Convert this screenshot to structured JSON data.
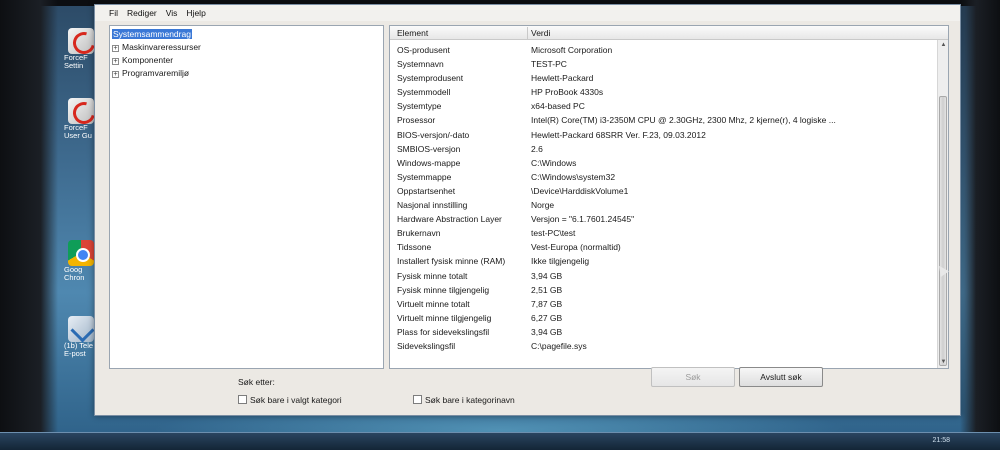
{
  "desktop": {
    "icons": [
      {
        "name": "forcefield-settings",
        "label": "ForceF\nSettin",
        "icon": "forcefield-icon"
      },
      {
        "name": "forcefield-userguide",
        "label": "ForceF\nUser Gu",
        "icon": "forcefield-icon"
      },
      {
        "name": "google-chrome",
        "label": "Goog\nChron",
        "icon": "chrome-icon"
      },
      {
        "name": "telenor",
        "label": "(1b) Tele\nE-post",
        "icon": "telenor-icon"
      }
    ],
    "clock": "21:58"
  },
  "window": {
    "menu": [
      "Fil",
      "Rediger",
      "Vis",
      "Hjelp"
    ],
    "tree": [
      {
        "label": "Systemsammendrag",
        "expander": "",
        "selected": true
      },
      {
        "label": "Maskinvareressurser",
        "expander": "+"
      },
      {
        "label": "Komponenter",
        "expander": "+"
      },
      {
        "label": "Programvaremiljø",
        "expander": "+"
      }
    ],
    "columns": {
      "element": "Element",
      "value": "Verdi"
    },
    "rows": [
      [
        "OS-produsent",
        "Microsoft Corporation"
      ],
      [
        "Systemnavn",
        "TEST-PC"
      ],
      [
        "Systemprodusent",
        "Hewlett-Packard"
      ],
      [
        "Systemmodell",
        "HP ProBook 4330s"
      ],
      [
        "Systemtype",
        "x64-based PC"
      ],
      [
        "Prosessor",
        "Intel(R) Core(TM) i3-2350M CPU @ 2.30GHz, 2300 Mhz, 2 kjerne(r), 4 logiske ..."
      ],
      [
        "BIOS-versjon/-dato",
        "Hewlett-Packard 68SRR Ver. F.23, 09.03.2012"
      ],
      [
        "SMBIOS-versjon",
        "2.6"
      ],
      [
        "Windows-mappe",
        "C:\\Windows"
      ],
      [
        "Systemmappe",
        "C:\\Windows\\system32"
      ],
      [
        "Oppstartsenhet",
        "\\Device\\HarddiskVolume1"
      ],
      [
        "Nasjonal innstilling",
        "Norge"
      ],
      [
        "Hardware Abstraction Layer",
        "Versjon = \"6.1.7601.24545\""
      ],
      [
        "Brukernavn",
        "test-PC\\test"
      ],
      [
        "Tidssone",
        "Vest-Europa (normaltid)"
      ],
      [
        "Installert fysisk minne (RAM)",
        "Ikke tilgjengelig"
      ],
      [
        "Fysisk minne totalt",
        "3,94 GB"
      ],
      [
        "Fysisk minne tilgjengelig",
        "2,51 GB"
      ],
      [
        "Virtuelt minne totalt",
        "7,87 GB"
      ],
      [
        "Virtuelt minne tilgjengelig",
        "6,27 GB"
      ],
      [
        "Plass for sidevekslingsfil",
        "3,94 GB"
      ],
      [
        "Sidevekslingsfil",
        "C:\\pagefile.sys"
      ]
    ],
    "search": {
      "label": "Søk etter:",
      "value": "",
      "search_button": "Søk",
      "close_search_button": "Avslutt søk",
      "only_selected_category": "Søk bare i valgt kategori",
      "only_category_names": "Søk bare i kategorinavn"
    }
  }
}
